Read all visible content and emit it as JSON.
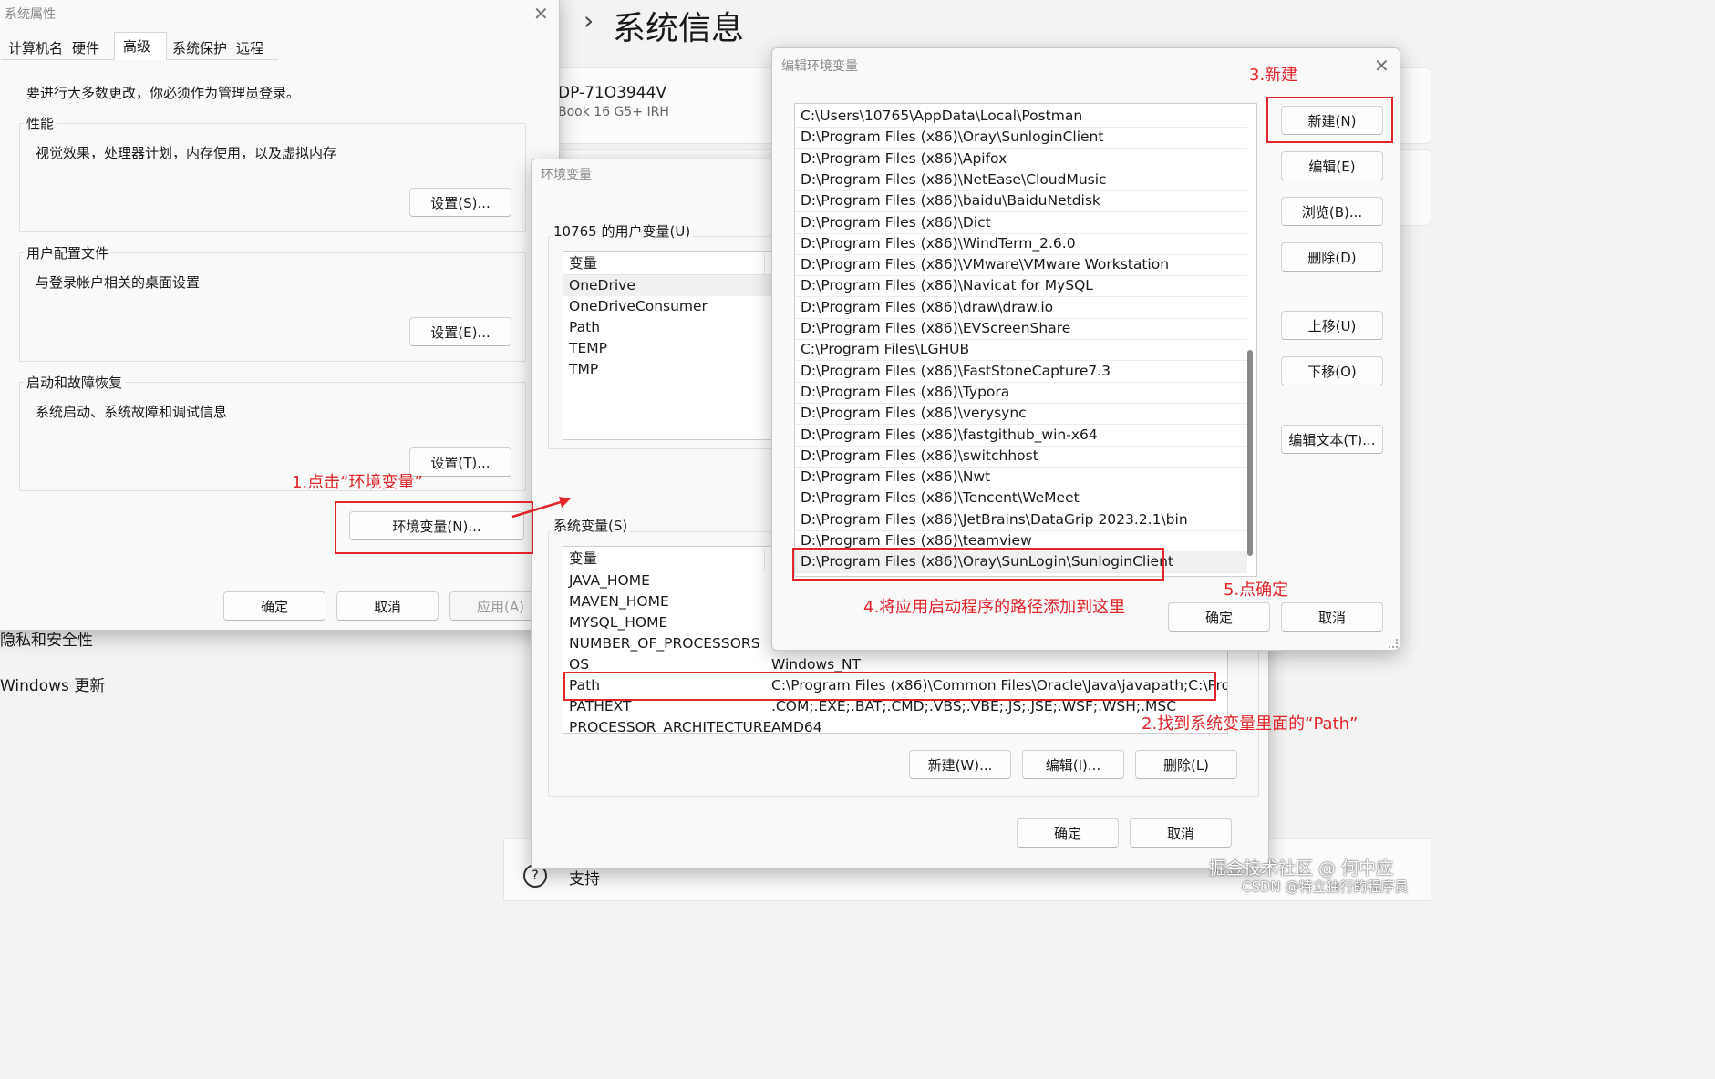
{
  "background": {
    "breadcrumb_chevron": "›",
    "page_title": "系统信息",
    "device_name": "DP-71O3944V",
    "device_model": "Book 16 G5+ IRH",
    "nav_privacy": "隐私和安全性",
    "nav_update": "Windows 更新",
    "support_icon": "?",
    "support_label": "支持"
  },
  "sysprops": {
    "title": "系统属性",
    "close_icon": "✕",
    "tabs": [
      "计算机名",
      "硬件",
      "高级",
      "系统保护",
      "远程"
    ],
    "admin_note": "要进行大多数更改，你必须作为管理员登录。",
    "perf": {
      "label": "性能",
      "desc": "视觉效果，处理器计划，内存使用，以及虚拟内存",
      "button": "设置(S)..."
    },
    "profile": {
      "label": "用户配置文件",
      "desc": "与登录帐户相关的桌面设置",
      "button": "设置(E)..."
    },
    "startup": {
      "label": "启动和故障恢复",
      "desc": "系统启动、系统故障和调试信息",
      "button": "设置(T)..."
    },
    "env_button": "环境变量(N)...",
    "ok": "确定",
    "cancel": "取消",
    "apply": "应用(A)"
  },
  "envvars": {
    "title": "环境变量",
    "user_group": "10765 的用户变量(U)",
    "user_header": "变量",
    "user_vars": [
      "OneDrive",
      "OneDriveConsumer",
      "Path",
      "TEMP",
      "TMP"
    ],
    "sys_group": "系统变量(S)",
    "sys_header": "变量",
    "sys_vars": [
      {
        "name": "JAVA_HOME",
        "value": ""
      },
      {
        "name": "MAVEN_HOME",
        "value": ""
      },
      {
        "name": "MYSQL_HOME",
        "value": ""
      },
      {
        "name": "NUMBER_OF_PROCESSORS",
        "value": ""
      },
      {
        "name": "OS",
        "value": "Windows_NT"
      },
      {
        "name": "Path",
        "value": "C:\\Program Files (x86)\\Common Files\\Oracle\\Java\\javapath;C:\\Pro..."
      },
      {
        "name": "PATHEXT",
        "value": ".COM;.EXE;.BAT;.CMD;.VBS;.VBE;.JS;.JSE;.WSF;.WSH;.MSC"
      },
      {
        "name": "PROCESSOR_ARCHITECTURE",
        "value": "AMD64"
      }
    ],
    "sys_new": "新建(W)...",
    "sys_edit": "编辑(I)...",
    "sys_delete": "删除(L)",
    "ok": "确定",
    "cancel": "取消"
  },
  "editenv": {
    "title": "编辑环境变量",
    "close_icon": "✕",
    "paths": [
      "C:\\Users\\10765\\AppData\\Local\\Postman",
      "D:\\Program Files (x86)\\Oray\\SunloginClient",
      "D:\\Program Files (x86)\\Apifox",
      "D:\\Program Files (x86)\\NetEase\\CloudMusic",
      "D:\\Program Files (x86)\\baidu\\BaiduNetdisk",
      "D:\\Program Files (x86)\\Dict",
      "D:\\Program Files (x86)\\WindTerm_2.6.0",
      "D:\\Program Files (x86)\\VMware\\VMware Workstation",
      "D:\\Program Files (x86)\\Navicat for MySQL",
      "D:\\Program Files (x86)\\draw\\draw.io",
      "D:\\Program Files (x86)\\EVScreenShare",
      "C:\\Program Files\\LGHUB",
      "D:\\Program Files (x86)\\FastStoneCapture7.3",
      "D:\\Program Files (x86)\\Typora",
      "D:\\Program Files (x86)\\verysync",
      "D:\\Program Files (x86)\\fastgithub_win-x64",
      "D:\\Program Files (x86)\\switchhost",
      "D:\\Program Files (x86)\\Nwt",
      "D:\\Program Files (x86)\\Tencent\\WeMeet",
      "D:\\Program Files (x86)\\JetBrains\\DataGrip 2023.2.1\\bin",
      "D:\\Program Files (x86)\\teamview",
      "D:\\Program Files (x86)\\Oray\\SunLogin\\SunloginClient"
    ],
    "buttons": {
      "new": "新建(N)",
      "edit": "编辑(E)",
      "browse": "浏览(B)...",
      "delete": "删除(D)",
      "up": "上移(U)",
      "down": "下移(O)",
      "edit_text": "编辑文本(T)..."
    },
    "ok": "确定",
    "cancel": "取消"
  },
  "annotations": {
    "step1": "1.点击“环境变量”",
    "step2": "2.找到系统变量里面的“Path”",
    "step3": "3.新建",
    "step4": "4.将应用启动程序的路径添加到这里",
    "step5": "5.点确定",
    "color": "#e0262b"
  },
  "watermark": {
    "line1": "掘金技术社区 @ 何中应",
    "line2": "CSDN @特立独行的程序员"
  }
}
